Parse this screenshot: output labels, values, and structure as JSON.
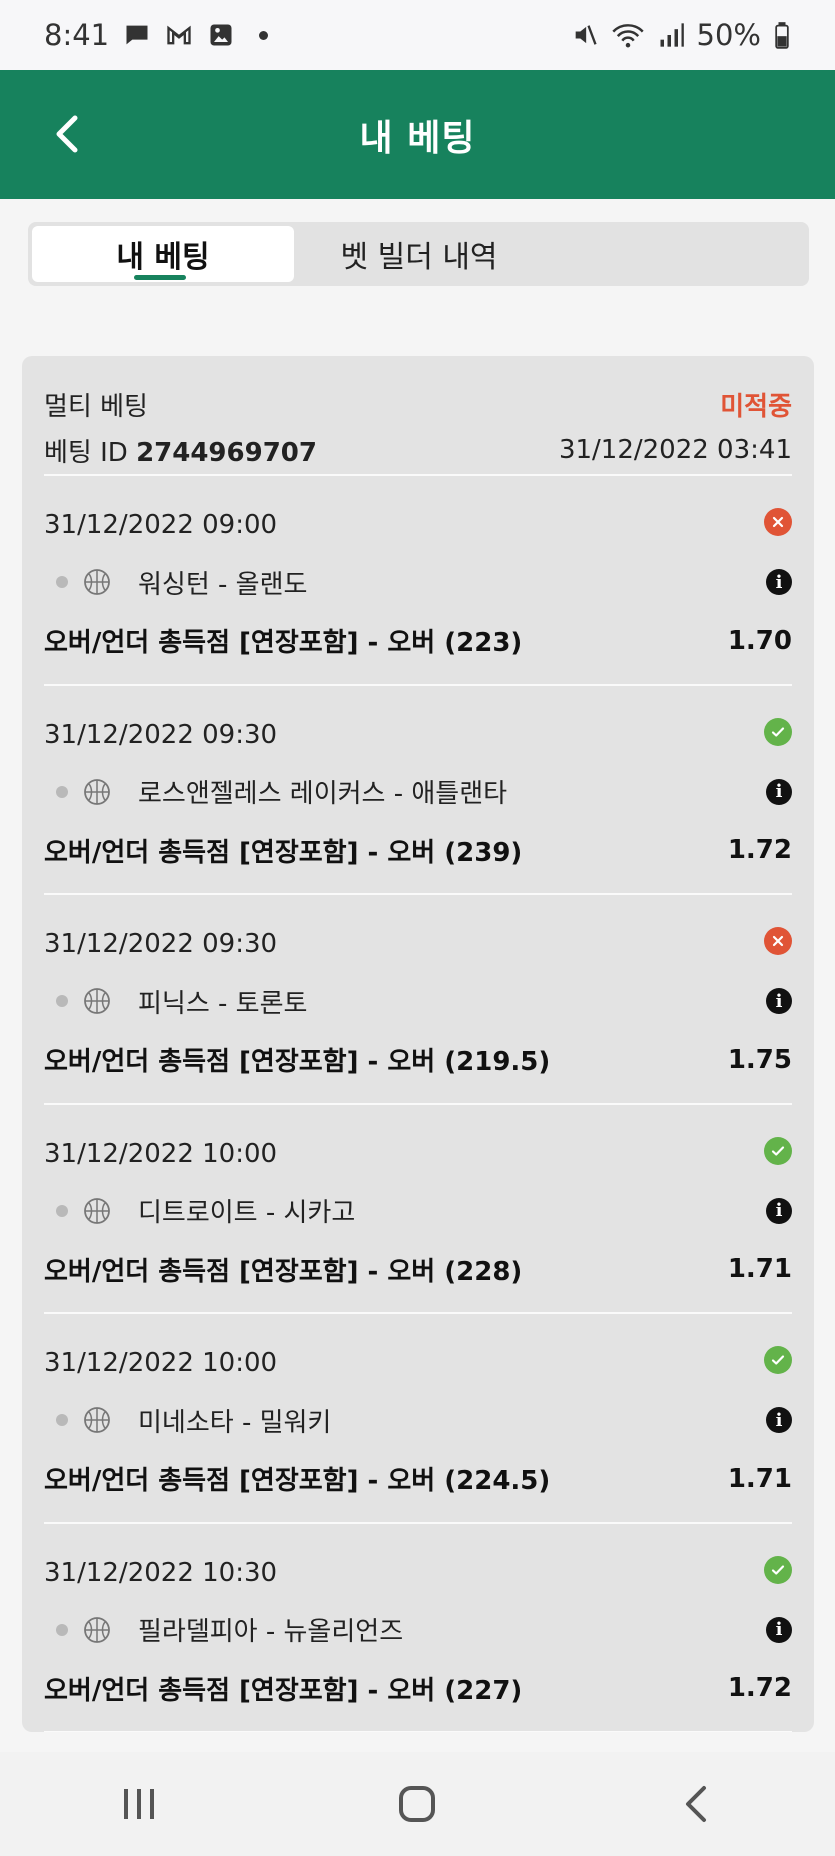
{
  "status_bar": {
    "time": "8:41",
    "battery": "50%"
  },
  "header": {
    "title": "내 베팅"
  },
  "tabs": [
    {
      "label": "내 베팅",
      "active": true
    },
    {
      "label": "벳 빌더 내역",
      "active": false
    }
  ],
  "bet": {
    "type": "멀티 베팅",
    "status": "미적중",
    "id_label": "베팅 ID",
    "id_value": "2744969707",
    "placed_at": "31/12/2022 03:41",
    "selections": [
      {
        "datetime": "31/12/2022 09:00",
        "result": "lost",
        "match": "워싱턴 - 올랜도",
        "market": "오버/언더 총득점 [연장포함] - 오버 (223)",
        "odds": "1.70"
      },
      {
        "datetime": "31/12/2022 09:30",
        "result": "won",
        "match": "로스앤젤레스 레이커스 - 애틀랜타",
        "market": "오버/언더 총득점 [연장포함] - 오버 (239)",
        "odds": "1.72"
      },
      {
        "datetime": "31/12/2022 09:30",
        "result": "lost",
        "match": "피닉스 - 토론토",
        "market": "오버/언더 총득점 [연장포함] - 오버 (219.5)",
        "odds": "1.75"
      },
      {
        "datetime": "31/12/2022 10:00",
        "result": "won",
        "match": "디트로이트 - 시카고",
        "market": "오버/언더 총득점 [연장포함] - 오버 (228)",
        "odds": "1.71"
      },
      {
        "datetime": "31/12/2022 10:00",
        "result": "won",
        "match": "미네소타 - 밀워키",
        "market": "오버/언더 총득점 [연장포함] - 오버 (224.5)",
        "odds": "1.71"
      },
      {
        "datetime": "31/12/2022 10:30",
        "result": "won",
        "match": "필라델피아 - 뉴올리언즈",
        "market": "오버/언더 총득점 [연장포함] - 오버 (227)",
        "odds": "1.72"
      }
    ]
  },
  "colors": {
    "brand": "#17825d",
    "lost": "#e05436",
    "won": "#63b34a"
  },
  "icons": {
    "back": "chevron-left-icon",
    "sport": "basketball-icon",
    "info": "info-icon",
    "nav_recents": "recents-icon",
    "nav_home": "home-icon",
    "nav_back": "back-icon"
  }
}
